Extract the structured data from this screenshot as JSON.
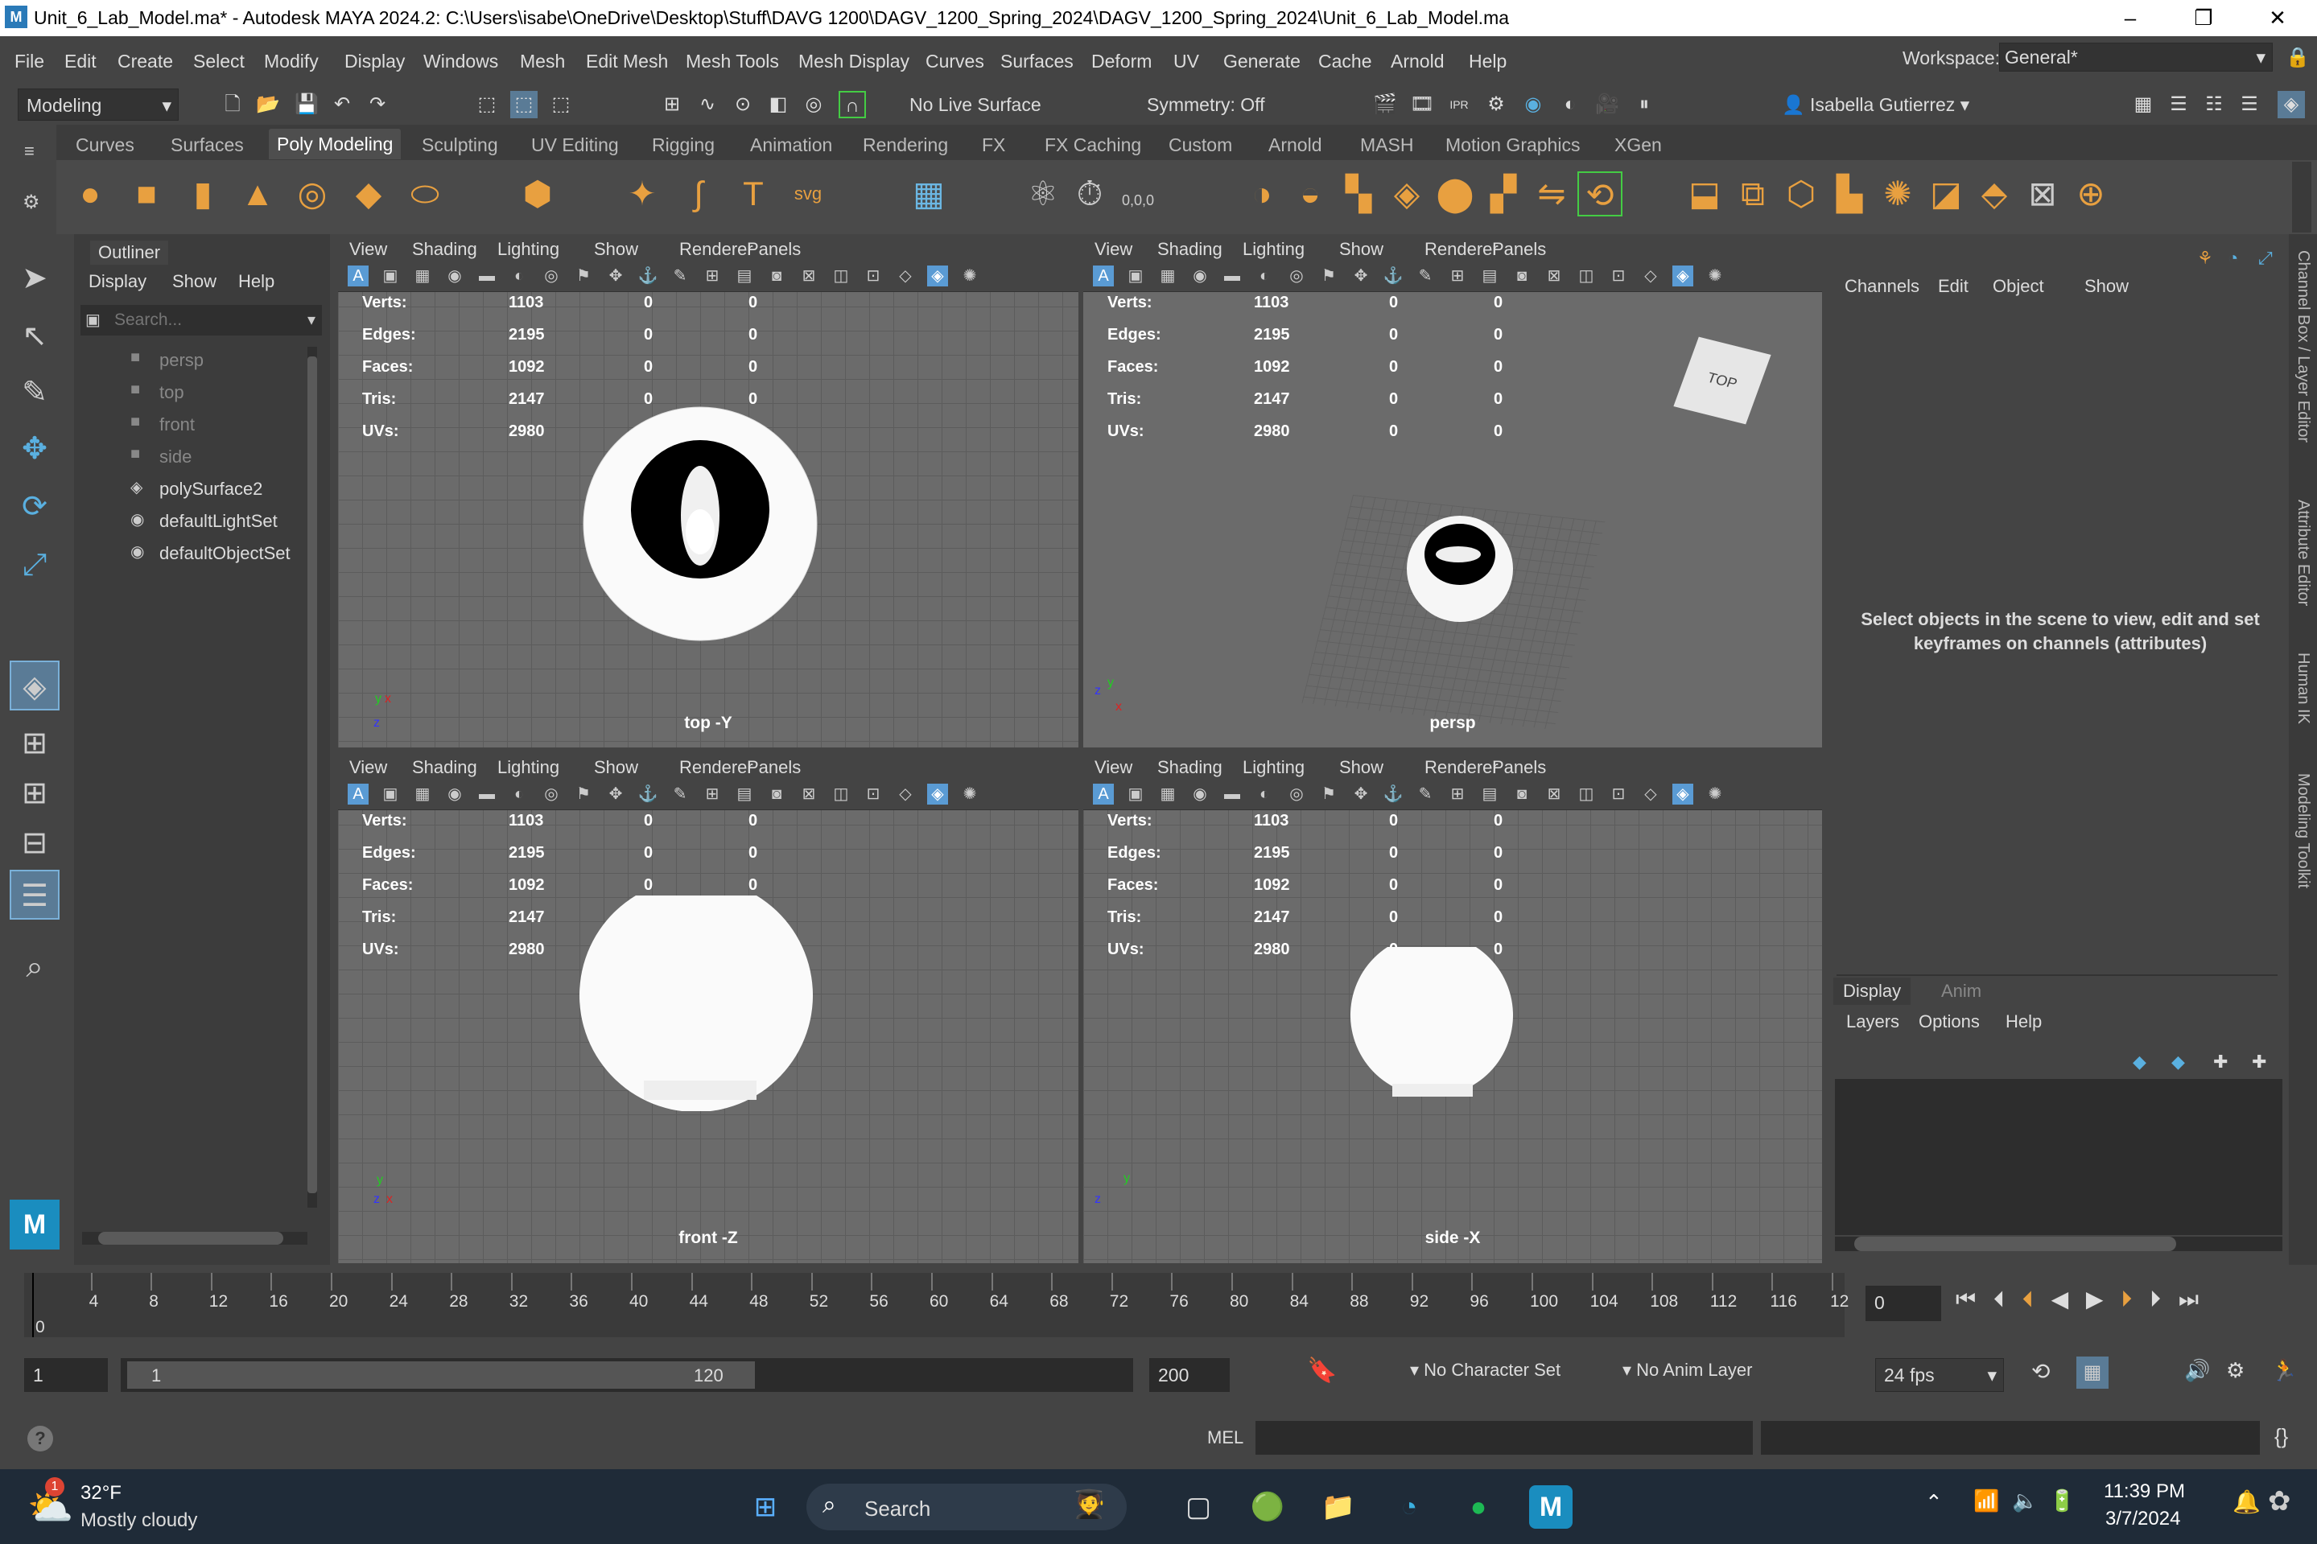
{
  "titlebar": {
    "title": "Unit_6_Lab_Model.ma* - Autodesk MAYA 2024.2: C:\\Users\\isabe\\OneDrive\\Desktop\\Stuff\\DAVG 1200\\DAGV_1200_Spring_2024\\DAGV_1200_Spring_2024\\Unit_6_Lab_Model.ma",
    "app_icon_letter": "M"
  },
  "menubar": {
    "items": [
      "File",
      "Edit",
      "Create",
      "Select",
      "Modify",
      "Display",
      "Windows",
      "Mesh",
      "Edit Mesh",
      "Mesh Tools",
      "Mesh Display",
      "Curves",
      "Surfaces",
      "Deform",
      "UV",
      "Generate",
      "Cache",
      "Arnold",
      "Help"
    ],
    "workspace_label": "Workspace:",
    "workspace_value": "General*"
  },
  "statusline": {
    "menuset": "Modeling",
    "live_surface": "No Live Surface",
    "symmetry": "Symmetry: Off",
    "user": "Isabella Gutierrez"
  },
  "shelf": {
    "tabs": [
      "Curves",
      "Surfaces",
      "Poly Modeling",
      "Sculpting",
      "UV Editing",
      "Rigging",
      "Animation",
      "Rendering",
      "FX",
      "FX Caching",
      "Custom",
      "Arnold",
      "MASH",
      "Motion Graphics",
      "XGen"
    ],
    "active_tab": "Poly Modeling",
    "text_icon": "T",
    "svg_icon": "svg",
    "snow_label": "0,0,0"
  },
  "outliner": {
    "title": "Outliner",
    "menus": [
      "Display",
      "Show",
      "Help"
    ],
    "search_placeholder": "Search...",
    "items": [
      {
        "label": "persp",
        "dim": true
      },
      {
        "label": "top",
        "dim": true
      },
      {
        "label": "front",
        "dim": true
      },
      {
        "label": "side",
        "dim": true
      },
      {
        "label": "polySurface2",
        "dim": false
      },
      {
        "label": "defaultLightSet",
        "dim": false
      },
      {
        "label": "defaultObjectSet",
        "dim": false
      }
    ]
  },
  "viewport": {
    "menus": [
      "View",
      "Shading",
      "Lighting",
      "Show",
      "Renderer",
      "Panels"
    ],
    "hud_labels": [
      "Verts:",
      "Edges:",
      "Faces:",
      "Tris:",
      "UVs:"
    ],
    "hud_values": [
      "1103",
      "2195",
      "1092",
      "2147",
      "2980"
    ],
    "hud_zeros": [
      "0",
      "0"
    ],
    "names": {
      "top": "top -Y",
      "persp": "persp",
      "front": "front -Z",
      "side": "side -X"
    },
    "viewcube_label": "TOP"
  },
  "channelbox": {
    "menus": [
      "Channels",
      "Edit",
      "Object",
      "Show"
    ],
    "empty_message": "Select objects in the scene to view, edit and set keyframes on channels (attributes)",
    "layer_tabs": [
      "Display",
      "Anim"
    ],
    "layer_menus": [
      "Layers",
      "Options",
      "Help"
    ]
  },
  "sidetabs": [
    "Channel Box / Layer Editor",
    "Attribute Editor",
    "Human IK",
    "Modeling Toolkit"
  ],
  "timeslider": {
    "ticks": [
      "0",
      "4",
      "8",
      "12",
      "16",
      "20",
      "24",
      "28",
      "32",
      "36",
      "40",
      "44",
      "48",
      "52",
      "56",
      "60",
      "64",
      "68",
      "72",
      "76",
      "80",
      "84",
      "88",
      "92",
      "96",
      "100",
      "104",
      "108",
      "112",
      "116",
      "12"
    ],
    "current_frame": "0"
  },
  "rangebar": {
    "start": "1",
    "range_start": "1",
    "range_end": "120",
    "end": "200",
    "character_set": "No Character Set",
    "anim_layer": "No Anim Layer",
    "fps": "24 fps"
  },
  "cmdline": {
    "mode": "MEL"
  },
  "taskbar": {
    "temp": "32°F",
    "weather": "Mostly cloudy",
    "weather_badge": "1",
    "search": "Search",
    "time": "11:39 PM",
    "date": "3/7/2024"
  },
  "colors": {
    "accent": "#5a9bd4",
    "shelf_orange": "#e8a040",
    "selection_blue": "#5a7b96"
  }
}
